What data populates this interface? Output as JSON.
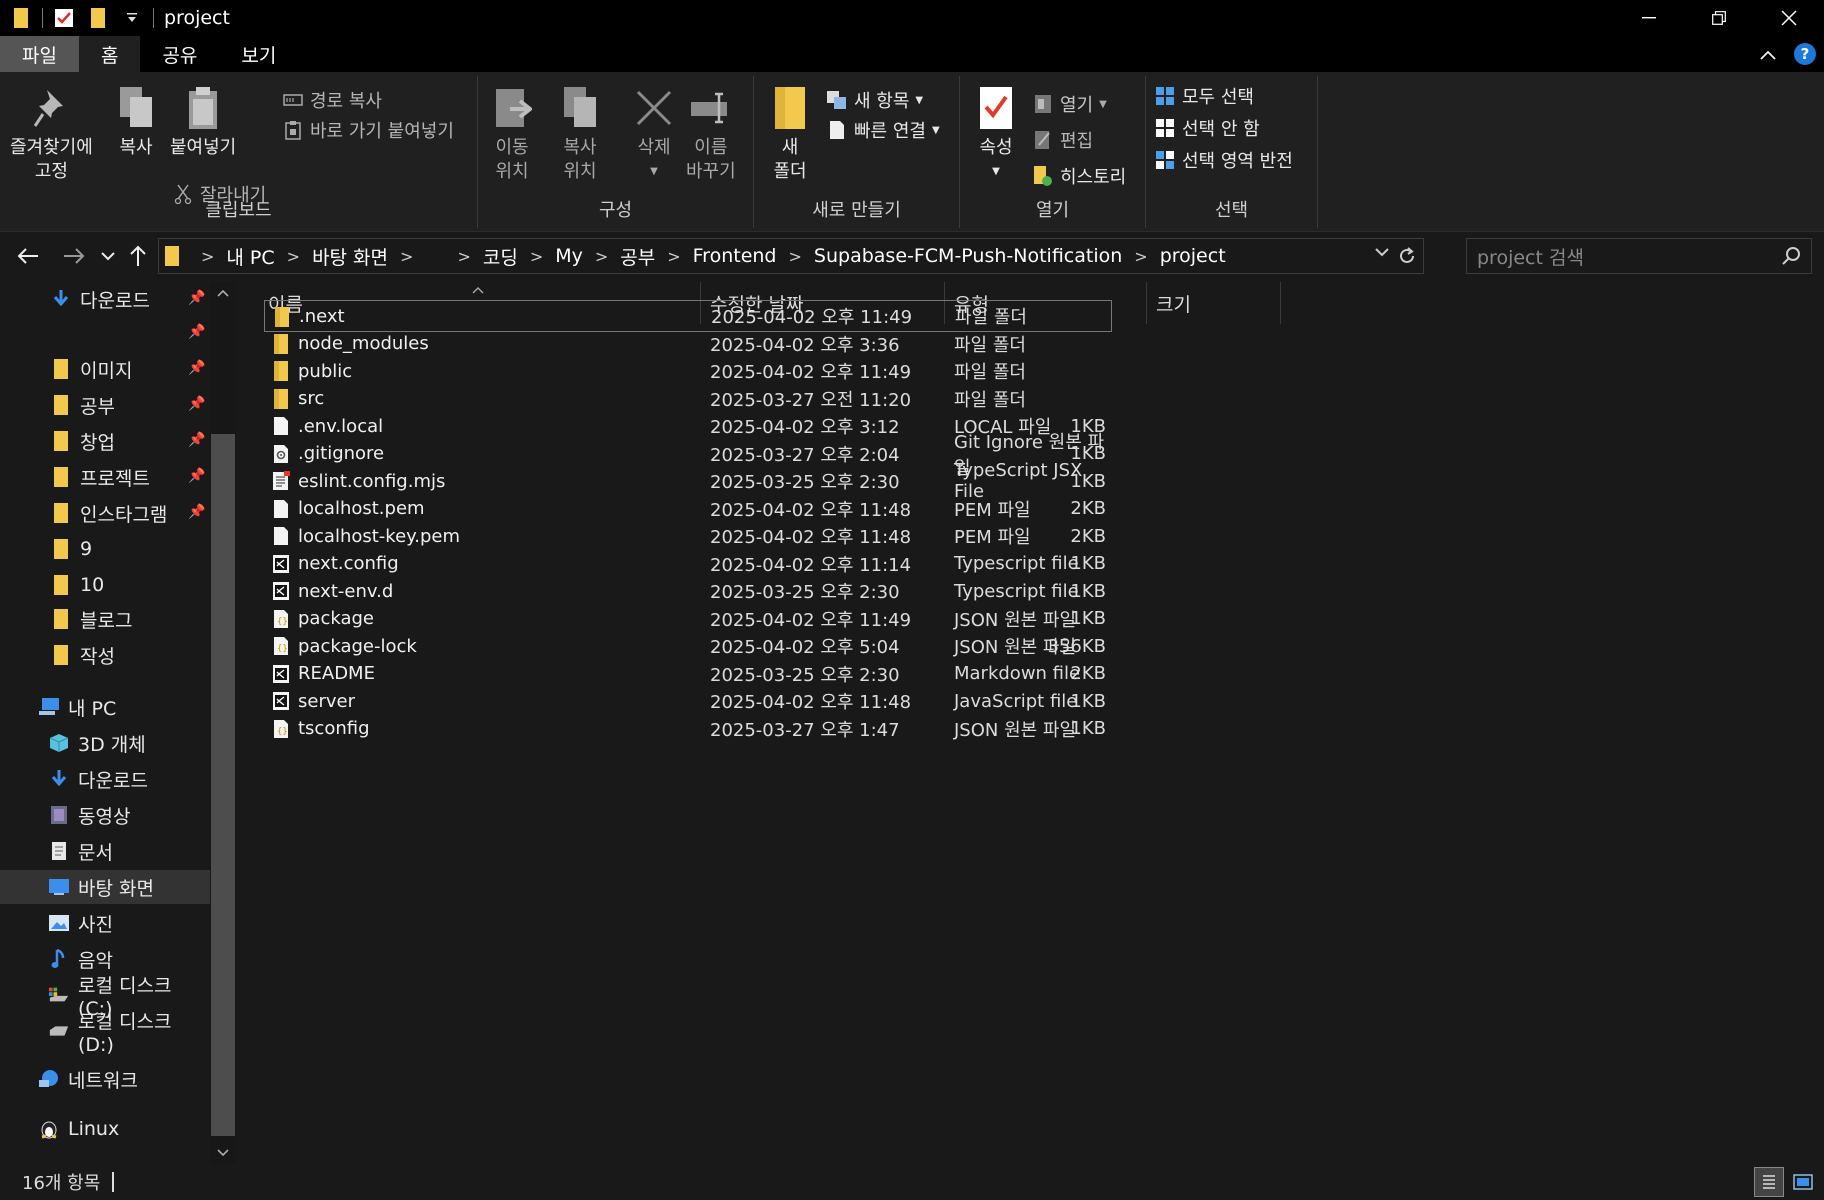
{
  "window": {
    "title": "project"
  },
  "tabs": {
    "file": "파일",
    "home": "홈",
    "share": "공유",
    "view": "보기"
  },
  "ribbon": {
    "clipboard": {
      "label": "클립보드",
      "pin_line1": "즐겨찾기에",
      "pin_line2": "고정",
      "copy": "복사",
      "paste": "붙여넣기",
      "copy_path": "경로 복사",
      "paste_shortcut": "바로 가기 붙여넣기",
      "cut": "잘라내기"
    },
    "organize": {
      "label": "구성",
      "move_line1": "이동",
      "move_line2": "위치",
      "copyto_line1": "복사",
      "copyto_line2": "위치",
      "delete": "삭제",
      "rename_line1": "이름",
      "rename_line2": "바꾸기"
    },
    "new": {
      "label": "새로 만들기",
      "new_folder_line1": "새",
      "new_folder_line2": "폴더",
      "new_item": "새 항목",
      "easy_access": "빠른 연결"
    },
    "open": {
      "label": "열기",
      "properties": "속성",
      "open": "열기",
      "edit": "편집",
      "history": "히스토리"
    },
    "select": {
      "label": "선택",
      "select_all": "모두 선택",
      "select_none": "선택 안 함",
      "invert": "선택 영역 반전"
    }
  },
  "address": {
    "crumbs": [
      "내 PC",
      "바탕 화면",
      "",
      "코딩",
      "My",
      "공부",
      "Frontend",
      "Supabase-FCM-Push-Notification",
      "project"
    ],
    "search_placeholder": "project 검색"
  },
  "sidebar": {
    "quick": [
      {
        "label": "다운로드",
        "icon": "download-arrow-icon",
        "pinned": true
      },
      {
        "label": "",
        "icon": "",
        "pinned": true
      },
      {
        "label": "이미지",
        "icon": "folder-icon",
        "pinned": true
      },
      {
        "label": "공부",
        "icon": "folder-icon",
        "pinned": true
      },
      {
        "label": "창업",
        "icon": "folder-icon",
        "pinned": true
      },
      {
        "label": "프로젝트",
        "icon": "folder-icon",
        "pinned": true
      },
      {
        "label": "인스타그램",
        "icon": "folder-icon",
        "pinned": true
      },
      {
        "label": "9",
        "icon": "folder-icon",
        "pinned": false
      },
      {
        "label": "10",
        "icon": "folder-icon",
        "pinned": false
      },
      {
        "label": "블로그",
        "icon": "folder-icon",
        "pinned": false
      },
      {
        "label": "작성",
        "icon": "folder-icon",
        "pinned": false
      }
    ],
    "this_pc": "내 PC",
    "pc_items": [
      {
        "label": "3D 개체",
        "icon": "3d-objects-icon"
      },
      {
        "label": "다운로드",
        "icon": "download-arrow-icon"
      },
      {
        "label": "동영상",
        "icon": "video-icon"
      },
      {
        "label": "문서",
        "icon": "document-icon"
      },
      {
        "label": "바탕 화면",
        "icon": "desktop-icon"
      },
      {
        "label": "사진",
        "icon": "pictures-icon"
      },
      {
        "label": "음악",
        "icon": "music-icon"
      },
      {
        "label": "로컬 디스크 (C:)",
        "icon": "drive-c-icon"
      },
      {
        "label": "로컬 디스크 (D:)",
        "icon": "drive-icon"
      }
    ],
    "network": "네트워크",
    "linux": "Linux"
  },
  "columns": {
    "name": "이름",
    "date": "수정한 날짜",
    "type": "유형",
    "size": "크기"
  },
  "files": [
    {
      "name": ".next",
      "date": "2025-04-02 오후 11:49",
      "type": "파일 폴더",
      "size": "",
      "icon": "folder"
    },
    {
      "name": "node_modules",
      "date": "2025-04-02 오후 3:36",
      "type": "파일 폴더",
      "size": "",
      "icon": "folder"
    },
    {
      "name": "public",
      "date": "2025-04-02 오후 11:49",
      "type": "파일 폴더",
      "size": "",
      "icon": "folder"
    },
    {
      "name": "src",
      "date": "2025-03-27 오전 11:20",
      "type": "파일 폴더",
      "size": "",
      "icon": "folder"
    },
    {
      "name": ".env.local",
      "date": "2025-04-02 오후 3:12",
      "type": "LOCAL 파일",
      "size": "1KB",
      "icon": "blank"
    },
    {
      "name": ".gitignore",
      "date": "2025-03-27 오후 2:04",
      "type": "Git Ignore 원본 파일",
      "size": "1KB",
      "icon": "gear"
    },
    {
      "name": "eslint.config.mjs",
      "date": "2025-03-25 오후 2:30",
      "type": "TypeScript JSX File",
      "size": "1KB",
      "icon": "script"
    },
    {
      "name": "localhost.pem",
      "date": "2025-04-02 오후 11:48",
      "type": "PEM 파일",
      "size": "2KB",
      "icon": "blank"
    },
    {
      "name": "localhost-key.pem",
      "date": "2025-04-02 오후 11:48",
      "type": "PEM 파일",
      "size": "2KB",
      "icon": "blank"
    },
    {
      "name": "next.config",
      "date": "2025-04-02 오후 11:14",
      "type": "Typescript file",
      "size": "1KB",
      "icon": "vscode"
    },
    {
      "name": "next-env.d",
      "date": "2025-03-25 오후 2:30",
      "type": "Typescript file",
      "size": "1KB",
      "icon": "vscode"
    },
    {
      "name": "package",
      "date": "2025-04-02 오후 11:49",
      "type": "JSON 원본 파일",
      "size": "1KB",
      "icon": "json"
    },
    {
      "name": "package-lock",
      "date": "2025-04-02 오후 5:04",
      "type": "JSON 원본 파일",
      "size": "356KB",
      "icon": "json"
    },
    {
      "name": "README",
      "date": "2025-03-25 오후 2:30",
      "type": "Markdown file",
      "size": "2KB",
      "icon": "vscode"
    },
    {
      "name": "server",
      "date": "2025-04-02 오후 11:48",
      "type": "JavaScript file",
      "size": "1KB",
      "icon": "vscode"
    },
    {
      "name": "tsconfig",
      "date": "2025-03-27 오후 1:47",
      "type": "JSON 원본 파일",
      "size": "1KB",
      "icon": "json"
    }
  ],
  "status": {
    "count": "16개 항목"
  },
  "colors": {
    "folder": "#f2c94c",
    "accent": "#1e78d7",
    "background": "#191919"
  }
}
